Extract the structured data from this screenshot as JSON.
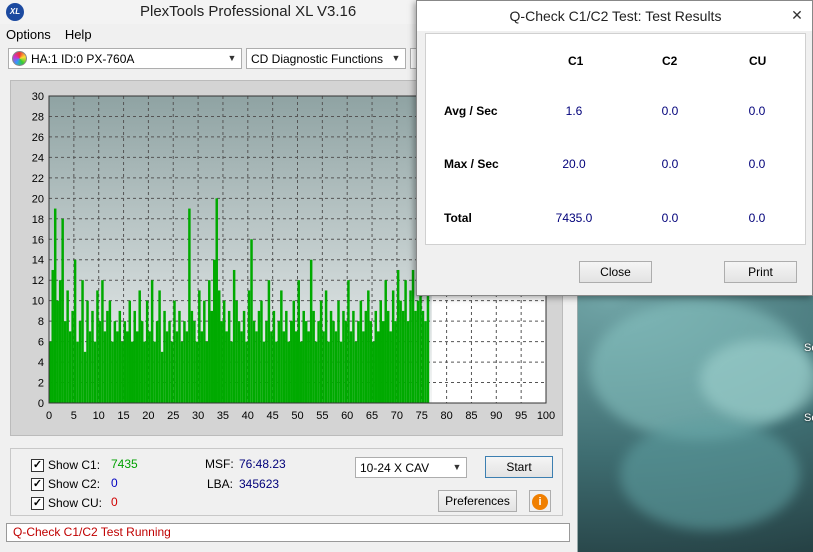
{
  "main": {
    "title": "PlexTools Professional XL V3.16",
    "logo_text": "XL",
    "menu": [
      "Options",
      "Help"
    ],
    "drive": "HA:1 ID:0  PX-760A",
    "function": "CD Diagnostic Functions",
    "show_c1_label": "Show C1:",
    "show_c1_value": "7435",
    "show_c2_label": "Show C2:",
    "show_c2_value": "0",
    "show_cu_label": "Show CU:",
    "show_cu_value": "0",
    "msf_label": "MSF:",
    "msf_value": "76:48.23",
    "lba_label": "LBA:",
    "lba_value": "345623",
    "speed": "10-24 X CAV",
    "start_label": "Start",
    "preferences_label": "Preferences",
    "info_glyph": "i",
    "status": "Q-Check C1/C2 Test Running",
    "colors": {
      "c1_value": "#00a000",
      "c2_value": "#0000c0",
      "cu_value": "#d00000",
      "bars": "#00aa00",
      "status": "#c00000"
    }
  },
  "dialog": {
    "title": "Q-Check C1/C2 Test: Test Results",
    "close_glyph": "✕",
    "columns": [
      "C1",
      "C2",
      "CU"
    ],
    "rows": [
      {
        "label": "Avg / Sec",
        "values": [
          "1.6",
          "0.0",
          "0.0"
        ]
      },
      {
        "label": "Max / Sec",
        "values": [
          "20.0",
          "0.0",
          "0.0"
        ]
      },
      {
        "label": "Total",
        "values": [
          "7435.0",
          "0.0",
          "0.0"
        ]
      }
    ],
    "close_label": "Close",
    "print_label": "Print"
  },
  "desktop": {
    "text_1": "Se",
    "text_2": "Se"
  },
  "chart_data": {
    "type": "bar",
    "x_range": [
      0,
      100
    ],
    "y_range": [
      0,
      30
    ],
    "x_ticks": [
      0,
      5,
      10,
      15,
      20,
      25,
      30,
      35,
      40,
      45,
      50,
      55,
      60,
      65,
      70,
      75,
      80,
      85,
      90,
      95,
      100
    ],
    "y_ticks": [
      0,
      2,
      4,
      6,
      8,
      10,
      12,
      14,
      16,
      18,
      20,
      22,
      24,
      26,
      28,
      30
    ],
    "grid": true,
    "progress_x": 77,
    "series": [
      {
        "x": [
          0.5,
          1,
          1.5,
          2,
          2.5,
          3,
          3.5,
          4,
          4.5,
          5,
          5.5,
          6,
          6.5,
          7,
          7.5,
          8,
          8.5,
          9,
          9.5,
          10,
          10.5,
          11,
          11.5,
          12,
          12.5,
          13,
          13.5,
          14,
          14.5,
          15,
          15.5,
          16,
          16.5,
          17,
          17.5,
          18,
          18.5,
          19,
          19.5,
          20,
          20.5,
          21,
          21.5,
          22,
          22.5,
          23,
          23.5,
          24,
          24.5,
          25,
          25.5,
          26,
          26.5,
          27,
          27.5,
          28,
          28.5,
          29,
          29.5,
          30,
          30.5,
          31,
          31.5,
          32,
          32.5,
          33,
          33.5,
          34,
          34.5,
          35,
          35.5,
          36,
          36.5,
          37,
          37.5,
          38,
          38.5,
          39,
          39.5,
          40,
          40.5,
          41,
          41.5,
          42,
          42.5,
          43,
          43.5,
          44,
          44.5,
          45,
          45.5,
          46,
          46.5,
          47,
          47.5,
          48,
          48.5,
          49,
          49.5,
          50,
          50.5,
          51,
          51.5,
          52,
          52.5,
          53,
          53.5,
          54,
          54.5,
          55,
          55.5,
          56,
          56.5,
          57,
          57.5,
          58,
          58.5,
          59,
          59.5,
          60,
          60.5,
          61,
          61.5,
          62,
          62.5,
          63,
          63.5,
          64,
          64.5,
          65,
          65.5,
          66,
          66.5,
          67,
          67.5,
          68,
          68.5,
          69,
          69.5,
          70,
          70.5,
          71,
          71.5,
          72,
          72.5,
          73,
          73.5,
          74,
          74.5,
          75,
          75.5,
          76,
          76.5
        ],
        "values": [
          6,
          13,
          19,
          10,
          12,
          18,
          8,
          11,
          7,
          9,
          14,
          6,
          8,
          12,
          5,
          10,
          7,
          9,
          6,
          11,
          8,
          12,
          7,
          9,
          10,
          6,
          8,
          7,
          9,
          6,
          8,
          7,
          10,
          6,
          9,
          7,
          11,
          8,
          6,
          10,
          7,
          12,
          6,
          8,
          11,
          5,
          9,
          7,
          8,
          6,
          10,
          7,
          9,
          6,
          8,
          7,
          19,
          9,
          8,
          6,
          11,
          7,
          10,
          6,
          12,
          9,
          14,
          20,
          11,
          8,
          10,
          7,
          9,
          6,
          13,
          10,
          8,
          7,
          9,
          6,
          11,
          16,
          8,
          7,
          9,
          10,
          6,
          8,
          12,
          7,
          9,
          6,
          8,
          11,
          7,
          9,
          6,
          8,
          10,
          7,
          12,
          6,
          9,
          8,
          7,
          14,
          9,
          6,
          8,
          10,
          7,
          11,
          6,
          9,
          8,
          7,
          10,
          6,
          9,
          8,
          12,
          7,
          9,
          6,
          8,
          10,
          7,
          9,
          11,
          8,
          6,
          9,
          7,
          10,
          8,
          12,
          9,
          7,
          11,
          8,
          13,
          10,
          9,
          12,
          8,
          11,
          13,
          9,
          10,
          12,
          9,
          8,
          11
        ]
      }
    ]
  }
}
